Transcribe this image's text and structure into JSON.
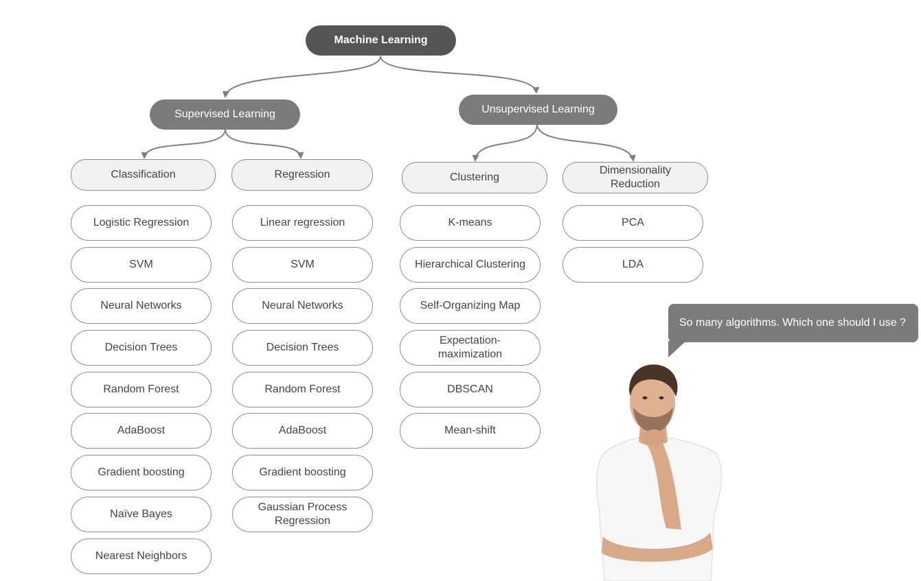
{
  "root": {
    "label": "Machine  Learning"
  },
  "supervised": {
    "label": "Supervised Learning",
    "classification": {
      "label": "Classification",
      "items": [
        "Logistic Regression",
        "SVM",
        "Neural Networks",
        "Decision Trees",
        "Random Forest",
        "AdaBoost",
        "Gradient boosting",
        "Naïve Bayes",
        "Nearest Neighbors"
      ]
    },
    "regression": {
      "label": "Regression",
      "items": [
        "Linear regression",
        "SVM",
        "Neural Networks",
        "Decision Trees",
        "Random Forest",
        "AdaBoost",
        "Gradient boosting",
        "Gaussian Process\nRegression"
      ]
    }
  },
  "unsupervised": {
    "label": "Unsupervised Learning",
    "clustering": {
      "label": "Clustering",
      "items": [
        "K-means",
        "Hierarchical Clustering",
        "Self-Organizing Map",
        "Expectation-\nmaximization",
        "DBSCAN",
        "Mean-shift"
      ]
    },
    "dimensionality": {
      "label": "Dimensionality\nReduction",
      "items": [
        "PCA",
        "LDA"
      ]
    }
  },
  "speech_bubble": {
    "text": "So many algorithms. Which one should I use ?"
  },
  "colors": {
    "root": "#555555",
    "level1": "#7b7b7b",
    "level2_fill": "#f1f1f1",
    "border": "#8c8c8c",
    "edge": "#7f7f7f"
  }
}
